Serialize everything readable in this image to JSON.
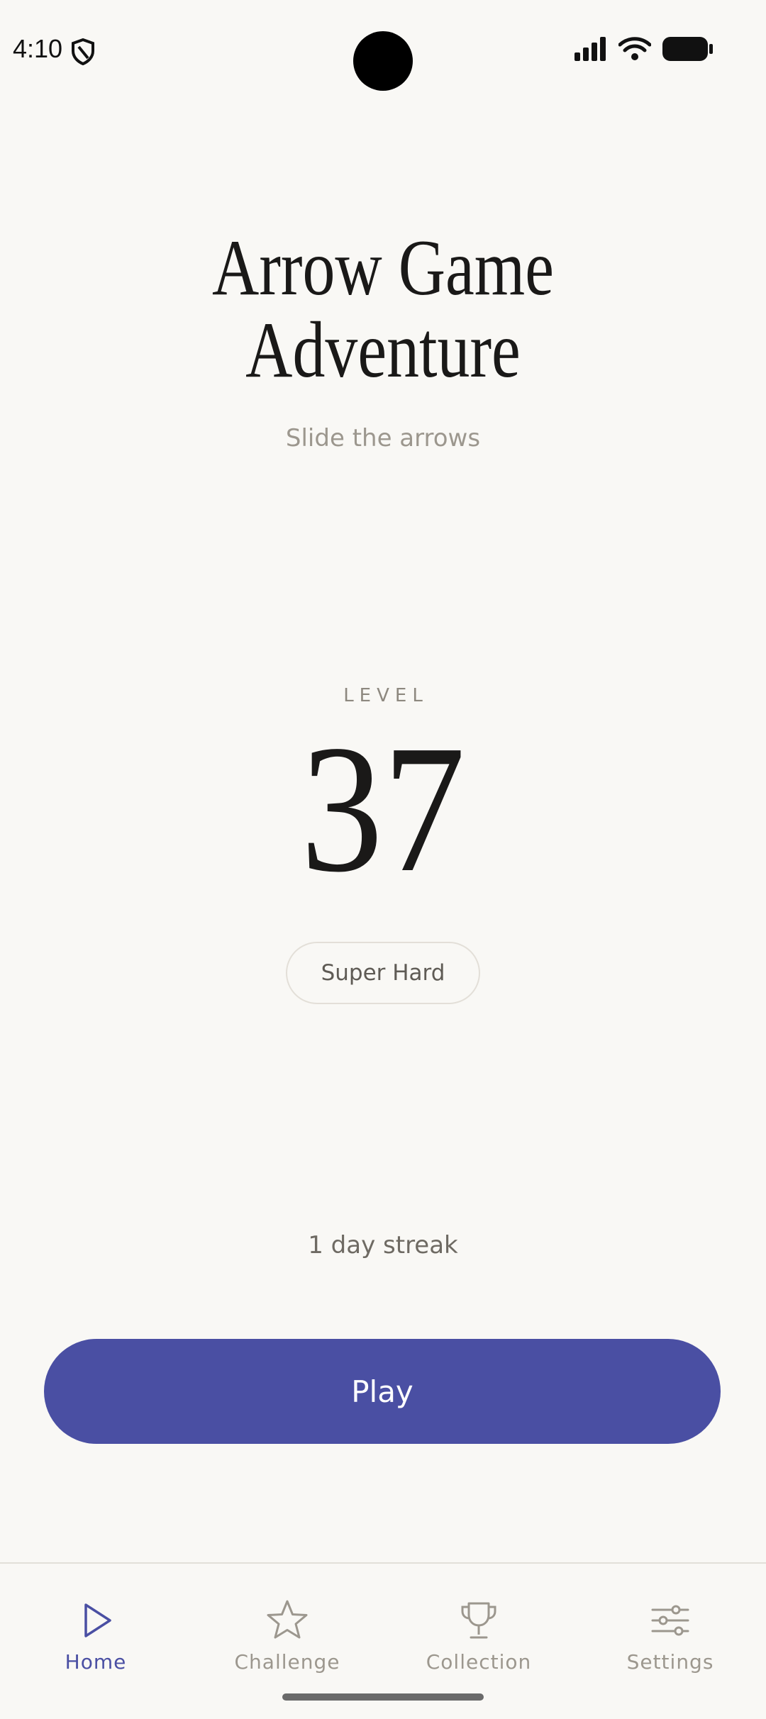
{
  "status_bar": {
    "time": "4:10",
    "icons": [
      "shield-icon",
      "signal-icon",
      "wifi-icon",
      "battery-icon"
    ]
  },
  "header": {
    "title": "Arrow Game\nAdventure",
    "subtitle": "Slide the arrows"
  },
  "level": {
    "label": "LEVEL",
    "number": "37",
    "difficulty": "Super Hard"
  },
  "streak": {
    "text": "1 day streak"
  },
  "play_button": {
    "label": "Play"
  },
  "bottom_nav": {
    "items": [
      {
        "label": "Home",
        "icon": "play-triangle-icon",
        "active": true
      },
      {
        "label": "Challenge",
        "icon": "star-icon",
        "active": false
      },
      {
        "label": "Collection",
        "icon": "trophy-icon",
        "active": false
      },
      {
        "label": "Settings",
        "icon": "sliders-icon",
        "active": false
      }
    ]
  },
  "colors": {
    "background": "#F9F8F5",
    "accent": "#4A4FA3",
    "text_primary": "#1A1918",
    "text_muted": "#9C978E"
  }
}
